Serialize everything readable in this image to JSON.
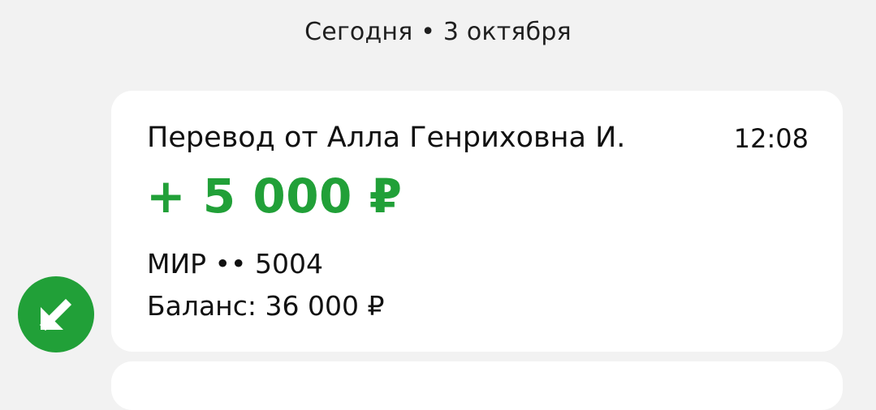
{
  "header": {
    "date": "Сегодня • 3 октября"
  },
  "transaction": {
    "title": "Перевод от Алла Генриховна И.",
    "time": "12:08",
    "amount": "+ 5 000 ₽",
    "card": "МИР •• 5004",
    "balance": "Баланс: 36 000 ₽",
    "icon": "incoming-arrow-icon",
    "accent_color": "#21a038"
  }
}
